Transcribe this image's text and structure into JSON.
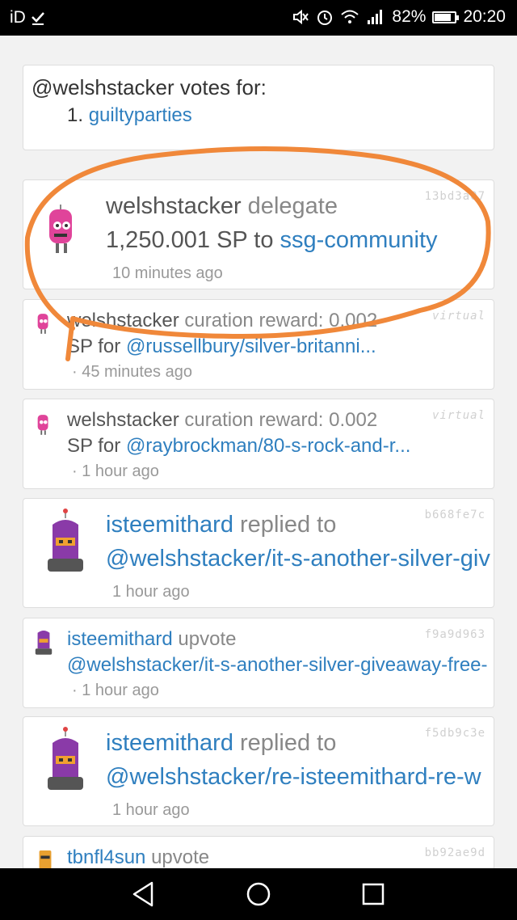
{
  "status_bar": {
    "left_text": "iD",
    "battery": "82%",
    "battery_level": 0.82,
    "time": "20:20"
  },
  "votes": {
    "title": "@welshstacker votes for:",
    "number": "1.",
    "witness": "guiltyparties"
  },
  "feed": [
    {
      "size": "big",
      "id": "13bd3a07",
      "user": "welshstacker",
      "action": " delegate",
      "line2_text": "1,250.001 SP to ",
      "line2_link": "ssg-community",
      "time": "10 minutes ago",
      "avatar": "pink-robot-avatar"
    },
    {
      "size": "small",
      "id": "virtual",
      "user": "welshstacker",
      "action": " curation reward: 0.002",
      "line2_text": "SP for ",
      "line2_link": "@russellbury/silver-britanni...",
      "time": "· 45 minutes ago",
      "avatar": "pink-robot-avatar"
    },
    {
      "size": "small",
      "id": "virtual",
      "user": "welshstacker",
      "action": " curation reward: 0.002",
      "line2_text": "SP for ",
      "line2_link": "@raybrockman/80-s-rock-and-r...",
      "time": "· 1 hour ago",
      "avatar": "pink-robot-avatar"
    },
    {
      "size": "big",
      "id": "b668fe7c",
      "user": "isteemithard",
      "action": " replied to",
      "line2_text": "",
      "line2_link": "@welshstacker/it-s-another-silver-giv",
      "time": "1 hour ago",
      "avatar": "purple-robot-avatar"
    },
    {
      "size": "small",
      "id": "f9a9d963",
      "user": "isteemithard",
      "action": " upvote",
      "line2_text": "",
      "line2_link": "@welshstacker/it-s-another-silver-giveaway-free-",
      "time": "· 1 hour ago",
      "avatar": "purple-robot-avatar"
    },
    {
      "size": "big",
      "id": "f5db9c3e",
      "user": "isteemithard",
      "action": " replied to",
      "line2_text": "",
      "line2_link": "@welshstacker/re-isteemithard-re-w",
      "time": "1 hour ago",
      "avatar": "purple-robot-avatar"
    },
    {
      "size": "small",
      "id": "bb92ae9d",
      "user": "tbnfl4sun",
      "action": " upvote",
      "line2_text": "",
      "line2_link": "",
      "time": "",
      "avatar": "orange-robot-avatar"
    }
  ],
  "colors": {
    "link": "#2f7fbf",
    "annotation": "#f0883a"
  },
  "nav": [
    "back-icon",
    "home-icon",
    "recents-icon"
  ]
}
